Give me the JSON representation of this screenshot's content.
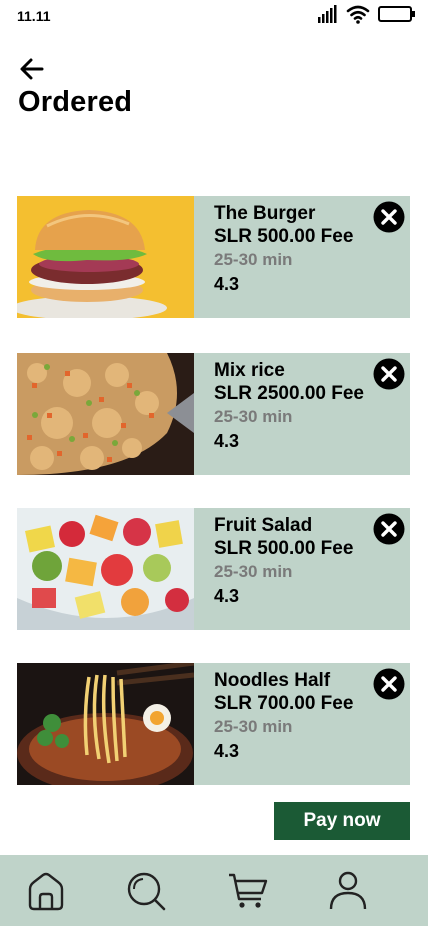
{
  "status_bar": {
    "time": "11.11"
  },
  "header": {
    "title": "Ordered"
  },
  "orders": [
    {
      "name": "The Burger",
      "price": "SLR 500.00 Fee",
      "eta": "25-30 min",
      "rating": "4.3",
      "image": "burger"
    },
    {
      "name": "Mix rice",
      "price": "SLR 2500.00 Fee",
      "eta": "25-30 min",
      "rating": "4.3",
      "image": "fried-rice"
    },
    {
      "name": "Fruit Salad",
      "price": "SLR 500.00 Fee",
      "eta": "25-30 min",
      "rating": "4.3",
      "image": "fruit-salad"
    },
    {
      "name": "Noodles Half",
      "price": "SLR 700.00 Fee",
      "eta": "25-30 min",
      "rating": "4.3",
      "image": "noodles"
    }
  ],
  "actions": {
    "pay_label": "Pay now"
  },
  "bottom_nav": [
    {
      "icon": "home-icon"
    },
    {
      "icon": "search-icon"
    },
    {
      "icon": "cart-icon"
    },
    {
      "icon": "profile-icon"
    }
  ],
  "colors": {
    "card_bg": "#bfd3c9",
    "pay_bg": "#1b5a35",
    "eta_text": "#7a7a7a"
  }
}
